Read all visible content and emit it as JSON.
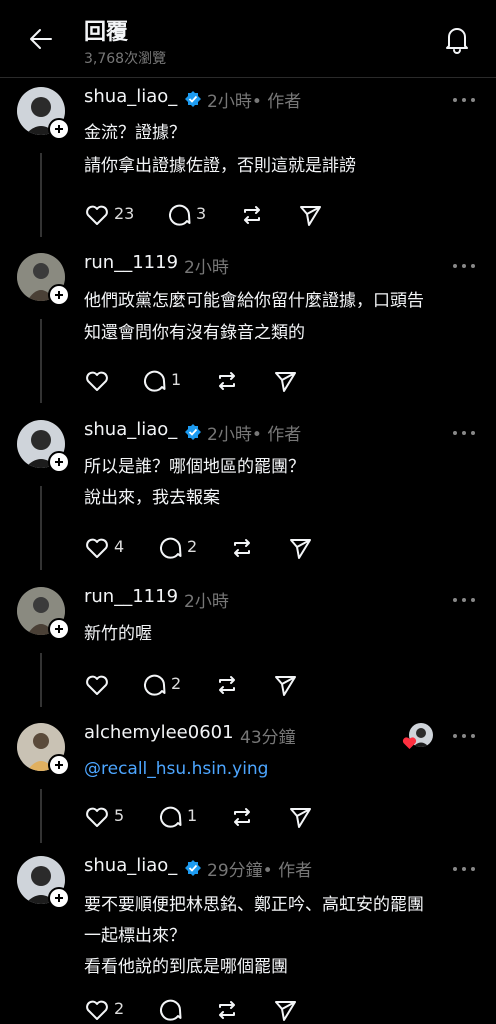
{
  "header": {
    "title": "回覆",
    "views": "3,768次瀏覽"
  },
  "posts": [
    {
      "username": "shua_liao_",
      "verified": true,
      "time": "2小時",
      "author_tag": "• 作者",
      "lines": [
        "金流？證據？",
        "請你拿出證據佐證，否則這就是誹謗"
      ],
      "likes": "23",
      "replies": "3"
    },
    {
      "username": "run__1119",
      "verified": false,
      "time": "2小時",
      "author_tag": "",
      "lines": [
        "他們政黨怎麼可能會給你留什麼證據，口頭告",
        "知還會問你有沒有錄音之類的"
      ],
      "likes": "",
      "replies": "1"
    },
    {
      "username": "shua_liao_",
      "verified": true,
      "time": "2小時",
      "author_tag": "• 作者",
      "lines": [
        "所以是誰？哪個地區的罷團？",
        "說出來，我去報案"
      ],
      "likes": "4",
      "replies": "2"
    },
    {
      "username": "run__1119",
      "verified": false,
      "time": "2小時",
      "author_tag": "",
      "lines": [
        "新竹的喔"
      ],
      "likes": "",
      "replies": "2"
    },
    {
      "username": "alchemylee0601",
      "verified": false,
      "time": "43分鐘",
      "author_tag": "",
      "lines": [
        "@recall_hsu.hsin.ying"
      ],
      "likes": "5",
      "replies": "1"
    },
    {
      "username": "shua_liao_",
      "verified": true,
      "time": "29分鐘",
      "author_tag": "• 作者",
      "lines": [
        "要不要順便把林思銘、鄭正吟、高虹安的罷團",
        "一起標出來？",
        "看看他說的到底是哪個罷團"
      ],
      "likes": "2",
      "replies": ""
    }
  ]
}
